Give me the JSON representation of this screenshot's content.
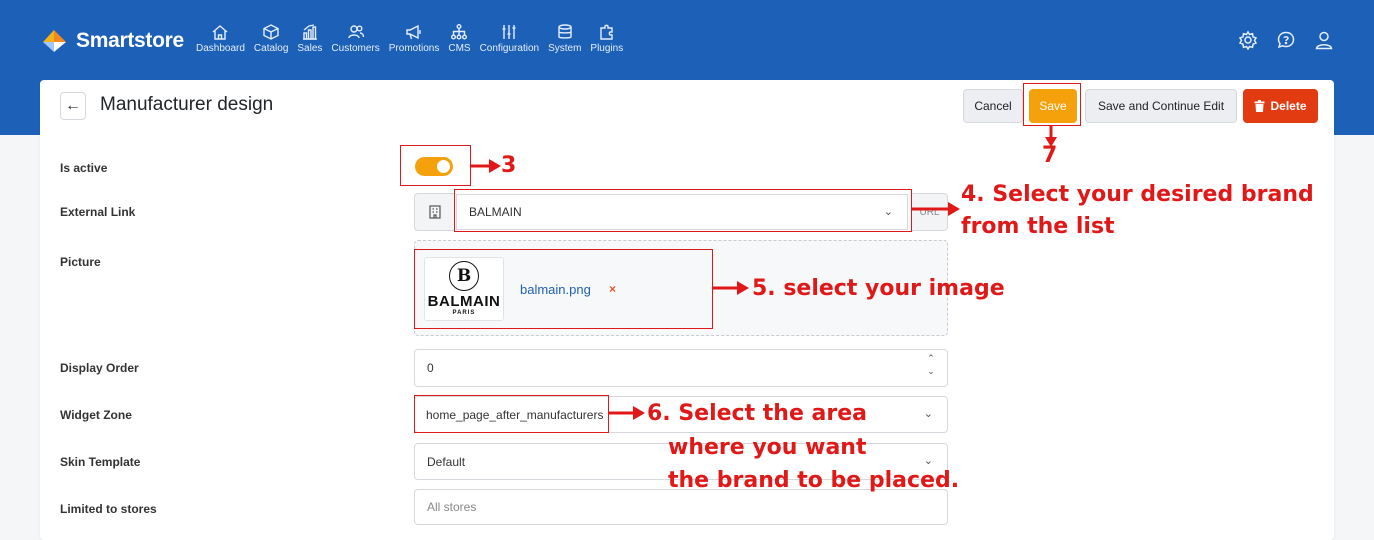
{
  "app": {
    "name": "Smartstore"
  },
  "nav": [
    {
      "label": "Dashboard",
      "icon": "home-icon"
    },
    {
      "label": "Catalog",
      "icon": "cube-icon"
    },
    {
      "label": "Sales",
      "icon": "bar-chart-icon"
    },
    {
      "label": "Customers",
      "icon": "users-icon"
    },
    {
      "label": "Promotions",
      "icon": "megaphone-icon"
    },
    {
      "label": "CMS",
      "icon": "sitemap-icon"
    },
    {
      "label": "Configuration",
      "icon": "sliders-icon"
    },
    {
      "label": "System",
      "icon": "database-icon"
    },
    {
      "label": "Plugins",
      "icon": "puzzle-icon"
    }
  ],
  "top_icons": [
    "gear-icon",
    "help-icon",
    "user-icon"
  ],
  "page": {
    "title": "Manufacturer design",
    "back_icon": "←"
  },
  "buttons": {
    "cancel": "Cancel",
    "save": "Save",
    "save_continue": "Save and Continue Edit",
    "delete": "Delete"
  },
  "form": {
    "is_active": {
      "label": "Is active",
      "value": true
    },
    "external_link": {
      "label": "External Link",
      "value": "BALMAIN",
      "addon_right": "URL"
    },
    "picture": {
      "label": "Picture",
      "filename": "balmain.png",
      "remove": "×",
      "logo_mark": "B",
      "logo_text": "BALMAIN",
      "logo_sub": "PARIS"
    },
    "display_order": {
      "label": "Display Order",
      "value": "0"
    },
    "widget_zone": {
      "label": "Widget Zone",
      "value": "home_page_after_manufacturers"
    },
    "skin_template": {
      "label": "Skin Template",
      "value": "Default"
    },
    "limited_to_stores": {
      "label": "Limited to stores",
      "placeholder": "All stores"
    }
  },
  "annotations": {
    "step3": "3",
    "step4_line1": "4. Select your desired brand",
    "step4_line2": "from the list",
    "step5": "5. select your image",
    "step6_line1": "6. Select the area",
    "step6_line2": "where you want",
    "step6_line3": "the brand to be placed.",
    "step7": "7",
    "color": "#e01818"
  },
  "colors": {
    "topbar": "#1d60b8",
    "accent": "#f4a10b",
    "danger": "#e23b12"
  }
}
